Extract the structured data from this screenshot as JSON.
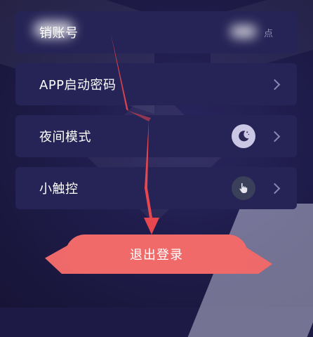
{
  "settings": {
    "items": [
      {
        "label": "销账号",
        "value": "点"
      },
      {
        "label": "APP启动密码"
      },
      {
        "label": "夜间模式",
        "icon": "moon-icon"
      },
      {
        "label": "小触控",
        "icon": "touch-hand-icon"
      }
    ]
  },
  "actions": {
    "logout_label": "退出登录"
  },
  "colors": {
    "background": "#1d1a45",
    "row": "#262356",
    "logout": "#f06a6a",
    "arrow": "#e8474f"
  }
}
